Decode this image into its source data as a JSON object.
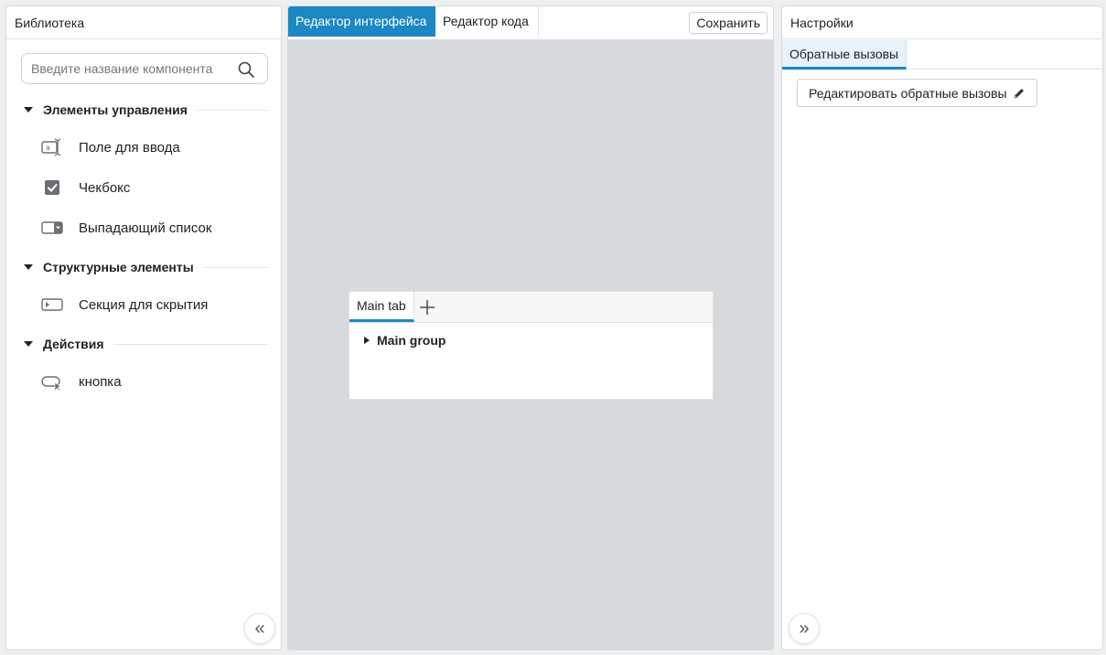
{
  "library": {
    "title": "Библиотека",
    "search": {
      "placeholder": "Введите название компонента",
      "value": ""
    },
    "groups": [
      {
        "title": "Элементы управления",
        "items": [
          {
            "label": "Поле для ввода",
            "icon": "text-input-icon"
          },
          {
            "label": "Чекбокс",
            "icon": "checkbox-icon"
          },
          {
            "label": "Выпадающий список",
            "icon": "dropdown-icon"
          }
        ]
      },
      {
        "title": "Структурные элементы",
        "items": [
          {
            "label": "Секция для скрытия",
            "icon": "collapsible-section-icon"
          }
        ]
      },
      {
        "title": "Действия",
        "items": [
          {
            "label": "кнопка",
            "icon": "button-click-icon"
          }
        ]
      }
    ],
    "collapse_glyph": "«"
  },
  "editor": {
    "tabs": [
      {
        "label": "Редактор интерфейса",
        "active": true
      },
      {
        "label": "Редактор кода",
        "active": false
      }
    ],
    "save_label": "Сохранить",
    "canvas": {
      "form_tabs": [
        {
          "label": "Main tab"
        }
      ],
      "add_tab_icon": "plus-icon",
      "group_label": "Main group"
    }
  },
  "settings": {
    "title": "Настройки",
    "tabs": [
      {
        "label": "Обратные вызовы"
      }
    ],
    "edit_callbacks_label": "Редактировать обратные вызовы",
    "collapse_glyph": "»"
  },
  "colors": {
    "accent": "#1b87c3",
    "canvas_bg": "#d7dadd",
    "icon_gray": "#6b6e72"
  }
}
